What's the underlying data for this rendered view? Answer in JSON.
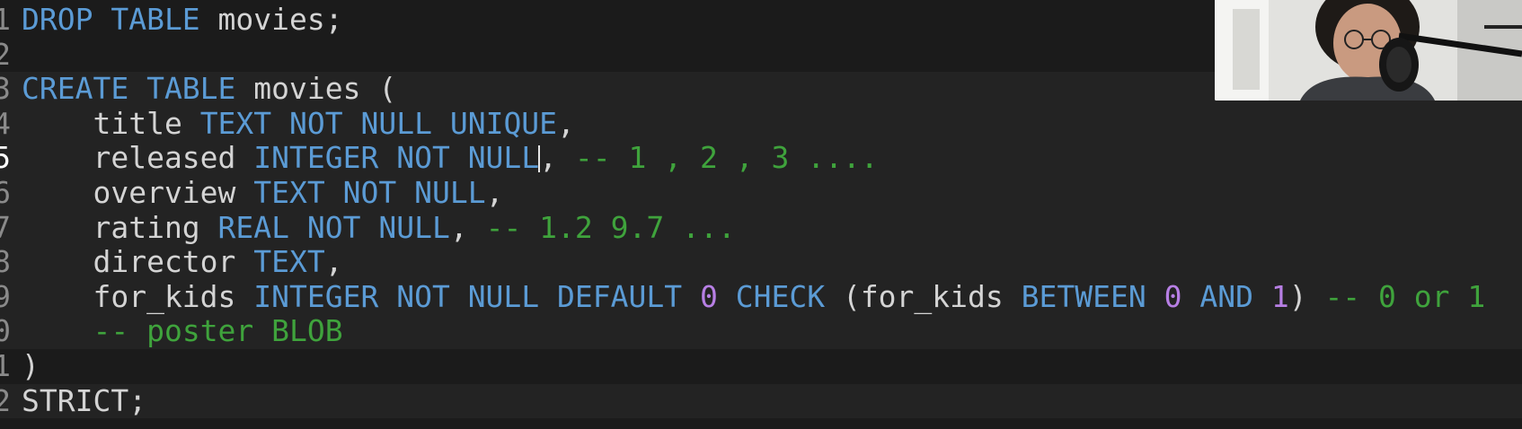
{
  "editor": {
    "lines": [
      {
        "num": "1",
        "tokens": [
          {
            "t": "DROP TABLE",
            "c": "kw"
          },
          {
            "t": " movies;",
            "c": "id"
          }
        ]
      },
      {
        "num": "2",
        "tokens": []
      },
      {
        "num": "3",
        "tokens": [
          {
            "t": "CREATE TABLE",
            "c": "kw"
          },
          {
            "t": " movies (",
            "c": "id"
          }
        ]
      },
      {
        "num": "4",
        "tokens": [
          {
            "t": "    title ",
            "c": "id"
          },
          {
            "t": "TEXT NOT NULL UNIQUE",
            "c": "kw"
          },
          {
            "t": ",",
            "c": "id"
          }
        ]
      },
      {
        "num": "5",
        "tokens": [
          {
            "t": "    released ",
            "c": "id"
          },
          {
            "t": "INTEGER NOT NULL",
            "c": "kw"
          },
          {
            "t": "|cursor|",
            "c": "cursor"
          },
          {
            "t": ", ",
            "c": "id"
          },
          {
            "t": "-- 1 , 2 , 3 ....",
            "c": "cmt"
          }
        ]
      },
      {
        "num": "6",
        "tokens": [
          {
            "t": "    overview ",
            "c": "id"
          },
          {
            "t": "TEXT NOT NULL",
            "c": "kw"
          },
          {
            "t": ",",
            "c": "id"
          }
        ]
      },
      {
        "num": "7",
        "tokens": [
          {
            "t": "    rating ",
            "c": "id"
          },
          {
            "t": "REAL NOT NULL",
            "c": "kw"
          },
          {
            "t": ", ",
            "c": "id"
          },
          {
            "t": "-- 1.2 9.7 ...",
            "c": "cmt"
          }
        ]
      },
      {
        "num": "8",
        "tokens": [
          {
            "t": "    director ",
            "c": "id"
          },
          {
            "t": "TEXT",
            "c": "kw"
          },
          {
            "t": ",",
            "c": "id"
          }
        ]
      },
      {
        "num": "9",
        "tokens": [
          {
            "t": "    for_kids ",
            "c": "id"
          },
          {
            "t": "INTEGER NOT NULL DEFAULT",
            "c": "kw"
          },
          {
            "t": " ",
            "c": "id"
          },
          {
            "t": "0",
            "c": "num"
          },
          {
            "t": " ",
            "c": "id"
          },
          {
            "t": "CHECK",
            "c": "kw"
          },
          {
            "t": " (for_kids ",
            "c": "id"
          },
          {
            "t": "BETWEEN",
            "c": "kw"
          },
          {
            "t": " ",
            "c": "id"
          },
          {
            "t": "0",
            "c": "num"
          },
          {
            "t": " ",
            "c": "id"
          },
          {
            "t": "AND",
            "c": "kw"
          },
          {
            "t": " ",
            "c": "id"
          },
          {
            "t": "1",
            "c": "num"
          },
          {
            "t": ") ",
            "c": "id"
          },
          {
            "t": "-- 0 or 1",
            "c": "cmt"
          }
        ]
      },
      {
        "num": "0",
        "tokens": [
          {
            "t": "    ",
            "c": "id"
          },
          {
            "t": "-- poster BLOB",
            "c": "cmt"
          }
        ]
      },
      {
        "num": "1",
        "tokens": [
          {
            "t": ")",
            "c": "id"
          }
        ]
      },
      {
        "num": "2",
        "tokens": [
          {
            "t": "STRICT;",
            "c": "id"
          }
        ]
      }
    ],
    "active_line_index": 4
  },
  "webcam": {
    "icon": "webcam-person-icon"
  },
  "colors": {
    "background": "#1b1b1b",
    "keyword": "#5b9bd5",
    "identifier": "#d4d4d4",
    "number": "#b77fe4",
    "comment": "#3fa33c"
  }
}
